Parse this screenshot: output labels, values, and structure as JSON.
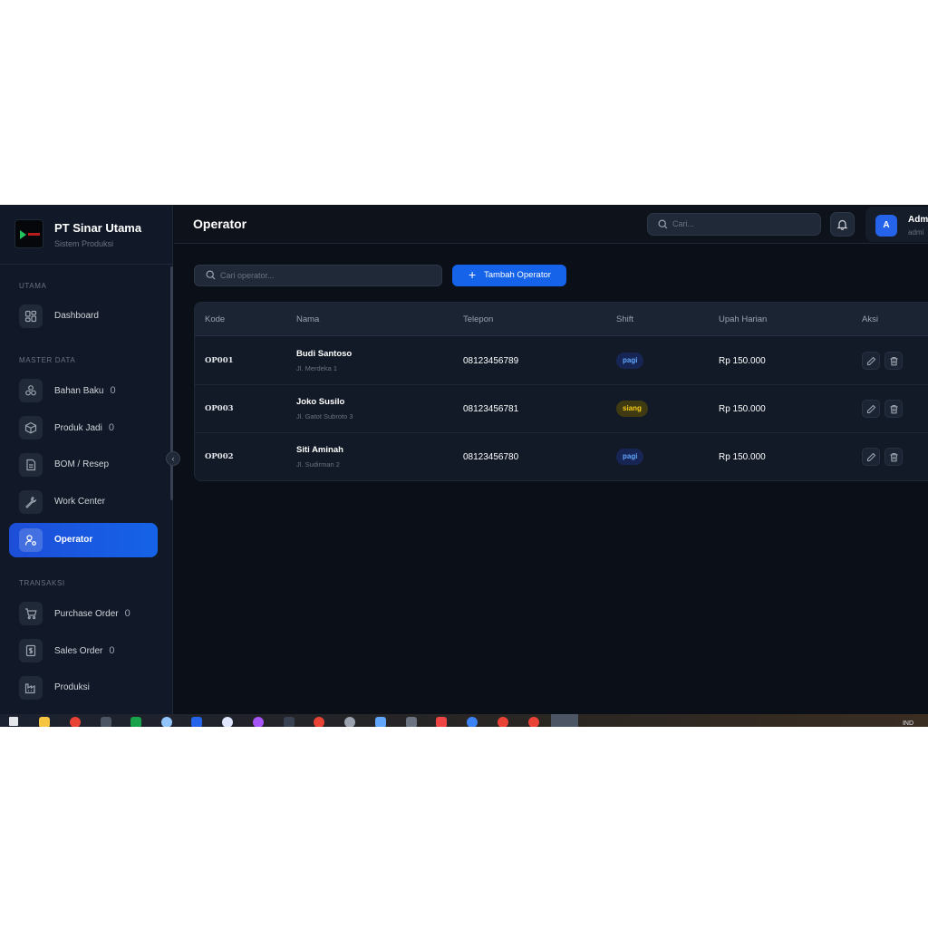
{
  "brand": {
    "title": "PT Sinar Utama",
    "subtitle": "Sistem Produksi"
  },
  "sidebar": {
    "sections": [
      {
        "label": "UTAMA",
        "items": [
          {
            "label": "Dashboard",
            "count": "",
            "icon": "dashboard-icon"
          }
        ]
      },
      {
        "label": "MASTER DATA",
        "items": [
          {
            "label": "Bahan Baku",
            "count": "0",
            "icon": "boxes-icon"
          },
          {
            "label": "Produk Jadi",
            "count": "0",
            "icon": "package-icon"
          },
          {
            "label": "BOM / Resep",
            "count": "",
            "icon": "document-icon"
          },
          {
            "label": "Work Center",
            "count": "",
            "icon": "wrench-icon"
          },
          {
            "label": "Operator",
            "count": "",
            "icon": "user-gear-icon",
            "active": true
          }
        ]
      },
      {
        "label": "TRANSAKSI",
        "items": [
          {
            "label": "Purchase Order",
            "count": "0",
            "icon": "cart-icon"
          },
          {
            "label": "Sales Order",
            "count": "0",
            "icon": "receipt-icon"
          },
          {
            "label": "Produksi",
            "count": "",
            "icon": "factory-icon"
          }
        ]
      }
    ]
  },
  "header": {
    "title": "Operator",
    "search_placeholder": "Cari...",
    "user": {
      "initial": "A",
      "name": "Adm",
      "role": "admi"
    }
  },
  "toolbar": {
    "search_placeholder": "Cari operator...",
    "add_label": "Tambah Operator"
  },
  "table": {
    "columns": [
      "Kode",
      "Nama",
      "Telepon",
      "Shift",
      "Upah Harian",
      "Aksi"
    ],
    "rows": [
      {
        "kode": "OP001",
        "nama": "Budi Santoso",
        "alamat": "Jl. Merdeka 1",
        "telepon": "08123456789",
        "shift": "pagi",
        "upah": "Rp 150.000"
      },
      {
        "kode": "OP003",
        "nama": "Joko Susilo",
        "alamat": "Jl. Gatot Subroto 3",
        "telepon": "08123456781",
        "shift": "siang",
        "upah": "Rp 150.000"
      },
      {
        "kode": "OP002",
        "nama": "Siti Aminah",
        "alamat": "Jl. Sudirman 2",
        "telepon": "08123456780",
        "shift": "pagi",
        "upah": "Rp 150.000"
      }
    ]
  },
  "colors": {
    "accent": "#1563e8",
    "shift_pagi_bg": "#172554",
    "shift_pagi_fg": "#60a5fa",
    "shift_siang_bg": "#3f3a12",
    "shift_siang_fg": "#facc15"
  },
  "taskbar": {
    "tray_text": "IND"
  }
}
